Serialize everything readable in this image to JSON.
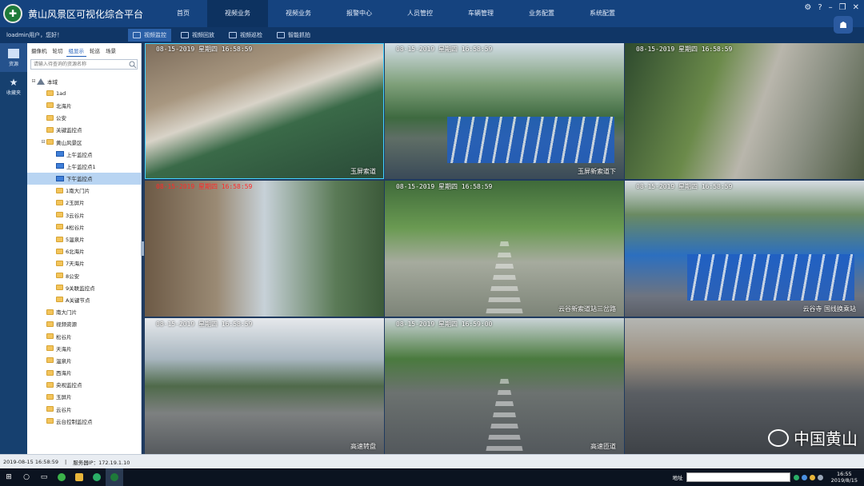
{
  "app": {
    "title": "黄山风景区可视化综合平台",
    "logo_glyph": "✚"
  },
  "nav": {
    "items": [
      "首页",
      "视频业务",
      "视频业务",
      "报警中心",
      "人员管控",
      "车辆管理",
      "业务配置",
      "系统配置"
    ],
    "active_index": 1
  },
  "window_controls": [
    "⚙",
    "?",
    "–",
    "❐",
    "✕"
  ],
  "subbar": {
    "welcome": "loadmin用户，您好！",
    "items": [
      "视频监控",
      "视频回放",
      "视频巡检",
      "智能抓拍"
    ],
    "active_index": 0,
    "bot_glyph": "☗"
  },
  "left_strip": {
    "items": [
      {
        "label": "资源",
        "icon": "monitor-icon"
      },
      {
        "label": "收藏夹",
        "icon": "star-icon"
      }
    ]
  },
  "tree": {
    "tabs": [
      "摄像机",
      "轮切",
      "组显示",
      "轮巡",
      "场景"
    ],
    "active_tab": 2,
    "search_placeholder": "请输入待查询的资源名称",
    "nodes": [
      {
        "label": "本域",
        "level": 0,
        "type": "home",
        "expander": "⊟"
      },
      {
        "label": "1ad",
        "level": 1,
        "type": "folder",
        "expander": ""
      },
      {
        "label": "北海片",
        "level": 1,
        "type": "folder",
        "expander": ""
      },
      {
        "label": "公安",
        "level": 1,
        "type": "folder",
        "expander": ""
      },
      {
        "label": "关键监控点",
        "level": 1,
        "type": "folder",
        "expander": ""
      },
      {
        "label": "黄山风景区",
        "level": 1,
        "type": "folder",
        "expander": "⊟"
      },
      {
        "label": "上午监控点",
        "level": 2,
        "type": "camera",
        "expander": ""
      },
      {
        "label": "上午监控点1",
        "level": 2,
        "type": "camera",
        "expander": ""
      },
      {
        "label": "下午监控点",
        "level": 2,
        "type": "camera",
        "expander": "",
        "selected": true
      },
      {
        "label": "1南大门片",
        "level": 2,
        "type": "folder",
        "expander": ""
      },
      {
        "label": "2玉屏片",
        "level": 2,
        "type": "folder",
        "expander": ""
      },
      {
        "label": "3云谷片",
        "level": 2,
        "type": "folder",
        "expander": ""
      },
      {
        "label": "4松谷片",
        "level": 2,
        "type": "folder",
        "expander": ""
      },
      {
        "label": "5温泉片",
        "level": 2,
        "type": "folder",
        "expander": ""
      },
      {
        "label": "6北海片",
        "level": 2,
        "type": "folder",
        "expander": ""
      },
      {
        "label": "7天海片",
        "level": 2,
        "type": "folder",
        "expander": ""
      },
      {
        "label": "8公安",
        "level": 2,
        "type": "folder",
        "expander": ""
      },
      {
        "label": "9关联监控点",
        "level": 2,
        "type": "folder",
        "expander": ""
      },
      {
        "label": "A关键节点",
        "level": 2,
        "type": "folder",
        "expander": ""
      },
      {
        "label": "南大门片",
        "level": 1,
        "type": "folder",
        "expander": ""
      },
      {
        "label": "视频资源",
        "level": 1,
        "type": "folder",
        "expander": ""
      },
      {
        "label": "松谷片",
        "level": 1,
        "type": "folder",
        "expander": ""
      },
      {
        "label": "天海片",
        "level": 1,
        "type": "folder",
        "expander": ""
      },
      {
        "label": "温泉片",
        "level": 1,
        "type": "folder",
        "expander": ""
      },
      {
        "label": "西海片",
        "level": 1,
        "type": "folder",
        "expander": ""
      },
      {
        "label": "央视监控点",
        "level": 1,
        "type": "folder",
        "expander": ""
      },
      {
        "label": "玉屏片",
        "level": 1,
        "type": "folder",
        "expander": ""
      },
      {
        "label": "云谷片",
        "level": 1,
        "type": "folder",
        "expander": ""
      },
      {
        "label": "云台控制监控点",
        "level": 1,
        "type": "folder",
        "expander": ""
      }
    ]
  },
  "videos": [
    {
      "time": "08-15-2019  星期四  16:58:59",
      "place": "玉屏索道",
      "red": false,
      "scene": "scene-1"
    },
    {
      "time": "08-15-2019  星期四  16:58:59",
      "place": "玉屏新索道下",
      "red": false,
      "scene": "scene-2"
    },
    {
      "time": "08-15-2019  星期四  16:58:59",
      "place": "",
      "red": false,
      "scene": "scene-3"
    },
    {
      "time": "08-15-2019  星期四  16:58:59",
      "place": "",
      "red": true,
      "scene": "scene-4"
    },
    {
      "time": "08-15-2019  星期四  16:58:59",
      "place": "云谷新索道站三岔路",
      "red": false,
      "scene": "scene-5"
    },
    {
      "time": "08-15-2019  星期四  16:58:59",
      "place": "云谷寺 国线换乘站",
      "red": false,
      "scene": "scene-6"
    },
    {
      "time": "08-15-2019  星期四  16:58:59",
      "place": "高速转盘",
      "red": false,
      "scene": "scene-7"
    },
    {
      "time": "08-15-2019  星期四  16:59:00",
      "place": "高速匝道",
      "red": false,
      "scene": "scene-8"
    },
    {
      "time": "",
      "place": "",
      "red": false,
      "scene": "scene-9"
    }
  ],
  "watermark": {
    "text": "中国黄山"
  },
  "statusbar": {
    "datetime": "2019-08-15  16:58:59",
    "server": "服务器IP：172.19.1.10"
  },
  "taskbar": {
    "address_label": "地址",
    "clock_time": "16:55",
    "clock_date": "2019/8/15"
  },
  "colors": {
    "topbar": "#15437f",
    "accent": "#2a5fa6",
    "tree_selected": "#b8d4f2",
    "osd_alert": "#ff2a2a"
  }
}
